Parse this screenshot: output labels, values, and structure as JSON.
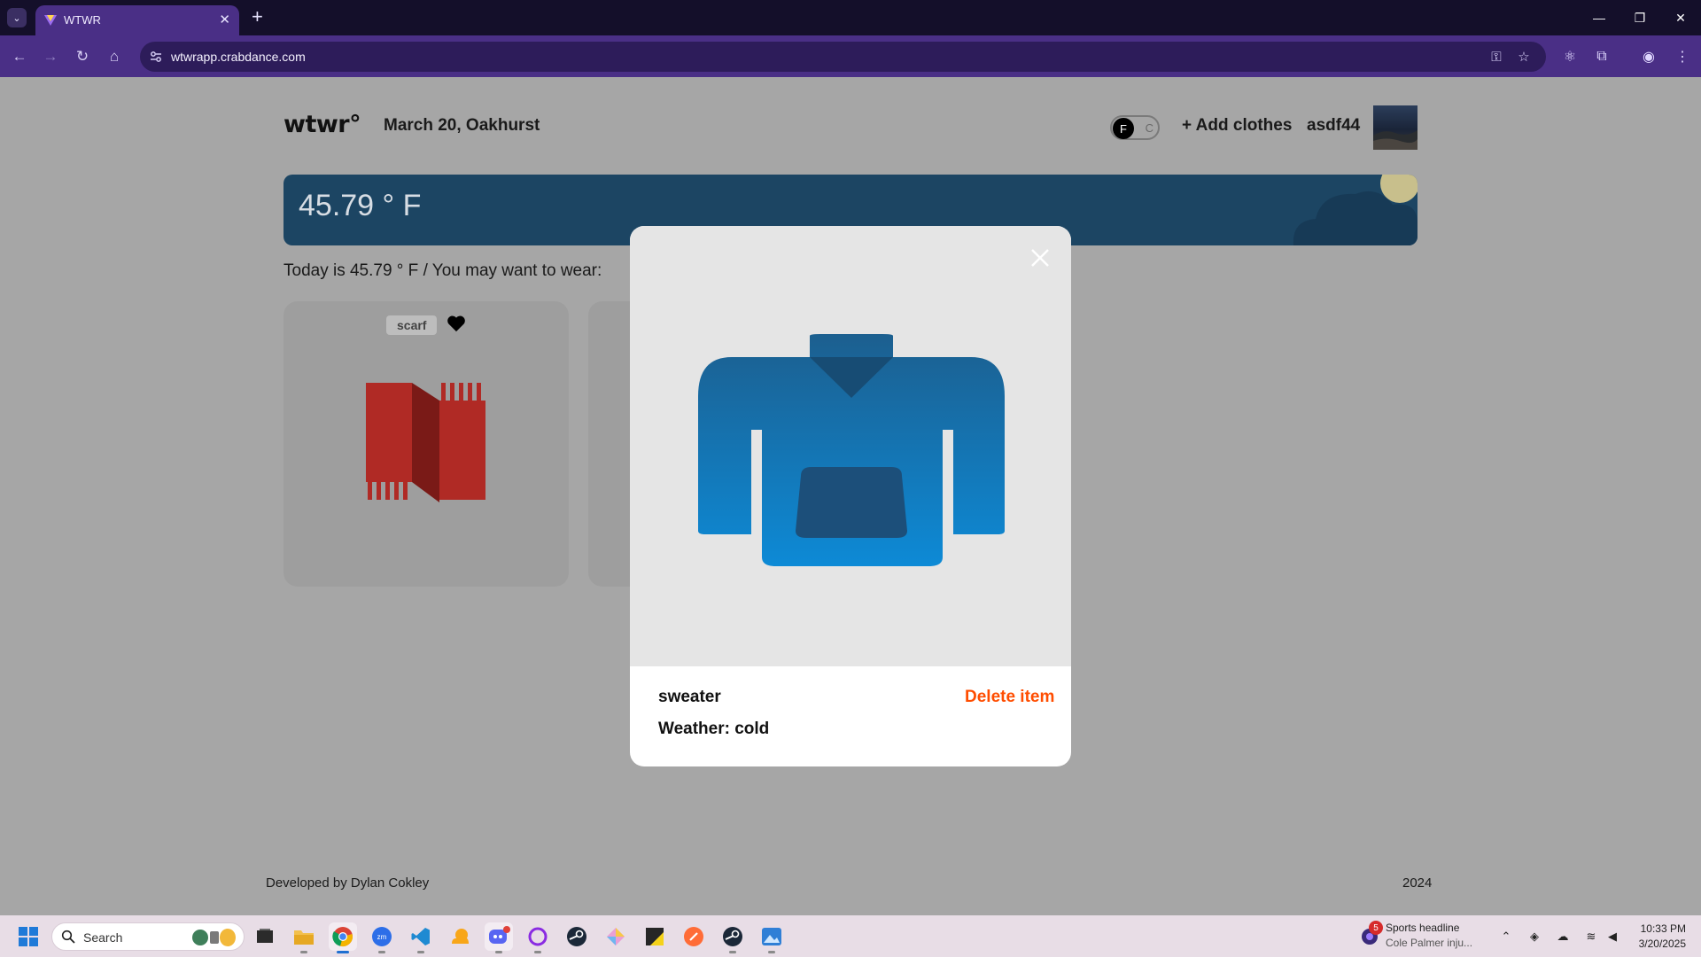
{
  "browser": {
    "tab_title": "WTWR",
    "url": "wtwrapp.crabdance.com",
    "new_tab_glyph": "+",
    "tab_close_glyph": "✕",
    "tab_menu_glyph": "⌄",
    "win_minimize": "—",
    "win_restore": "❐",
    "win_close": "✕"
  },
  "header": {
    "logo": "wtwr°",
    "date_location": "March 20, Oakhurst",
    "toggle_f": "F",
    "toggle_c": "C",
    "add_clothes": "+ Add clothes",
    "username": "asdf44"
  },
  "weather": {
    "temperature": "45.79 ° F",
    "condition_icon": "cloud-sun-icon",
    "colors": {
      "card": "#1c4563",
      "cloud": "#173a56",
      "sun": "#c8bf8c"
    }
  },
  "main": {
    "wear_text": "Today is 45.79 ° F / You may want to wear:",
    "cards": [
      {
        "label": "scarf",
        "liked": true,
        "image_icon": "scarf-icon"
      }
    ]
  },
  "modal": {
    "item_name": "sweater",
    "delete_label": "Delete item",
    "weather_label": "Weather: cold",
    "image_icon": "sweater-icon",
    "close_icon": "close-icon"
  },
  "footer": {
    "developer": "Developed by Dylan Cokley",
    "year": "2024"
  },
  "taskbar": {
    "search_placeholder": "Search",
    "news_badge": "5",
    "news_title": "Sports headline",
    "news_subtitle": "Cole Palmer inju...",
    "time": "10:33 PM",
    "date": "3/20/2025"
  },
  "colors": {
    "overlay_page_bg": "#a6a6a6",
    "delete_accent": "#ff4d00",
    "browser_frame": "#4a2f86"
  }
}
